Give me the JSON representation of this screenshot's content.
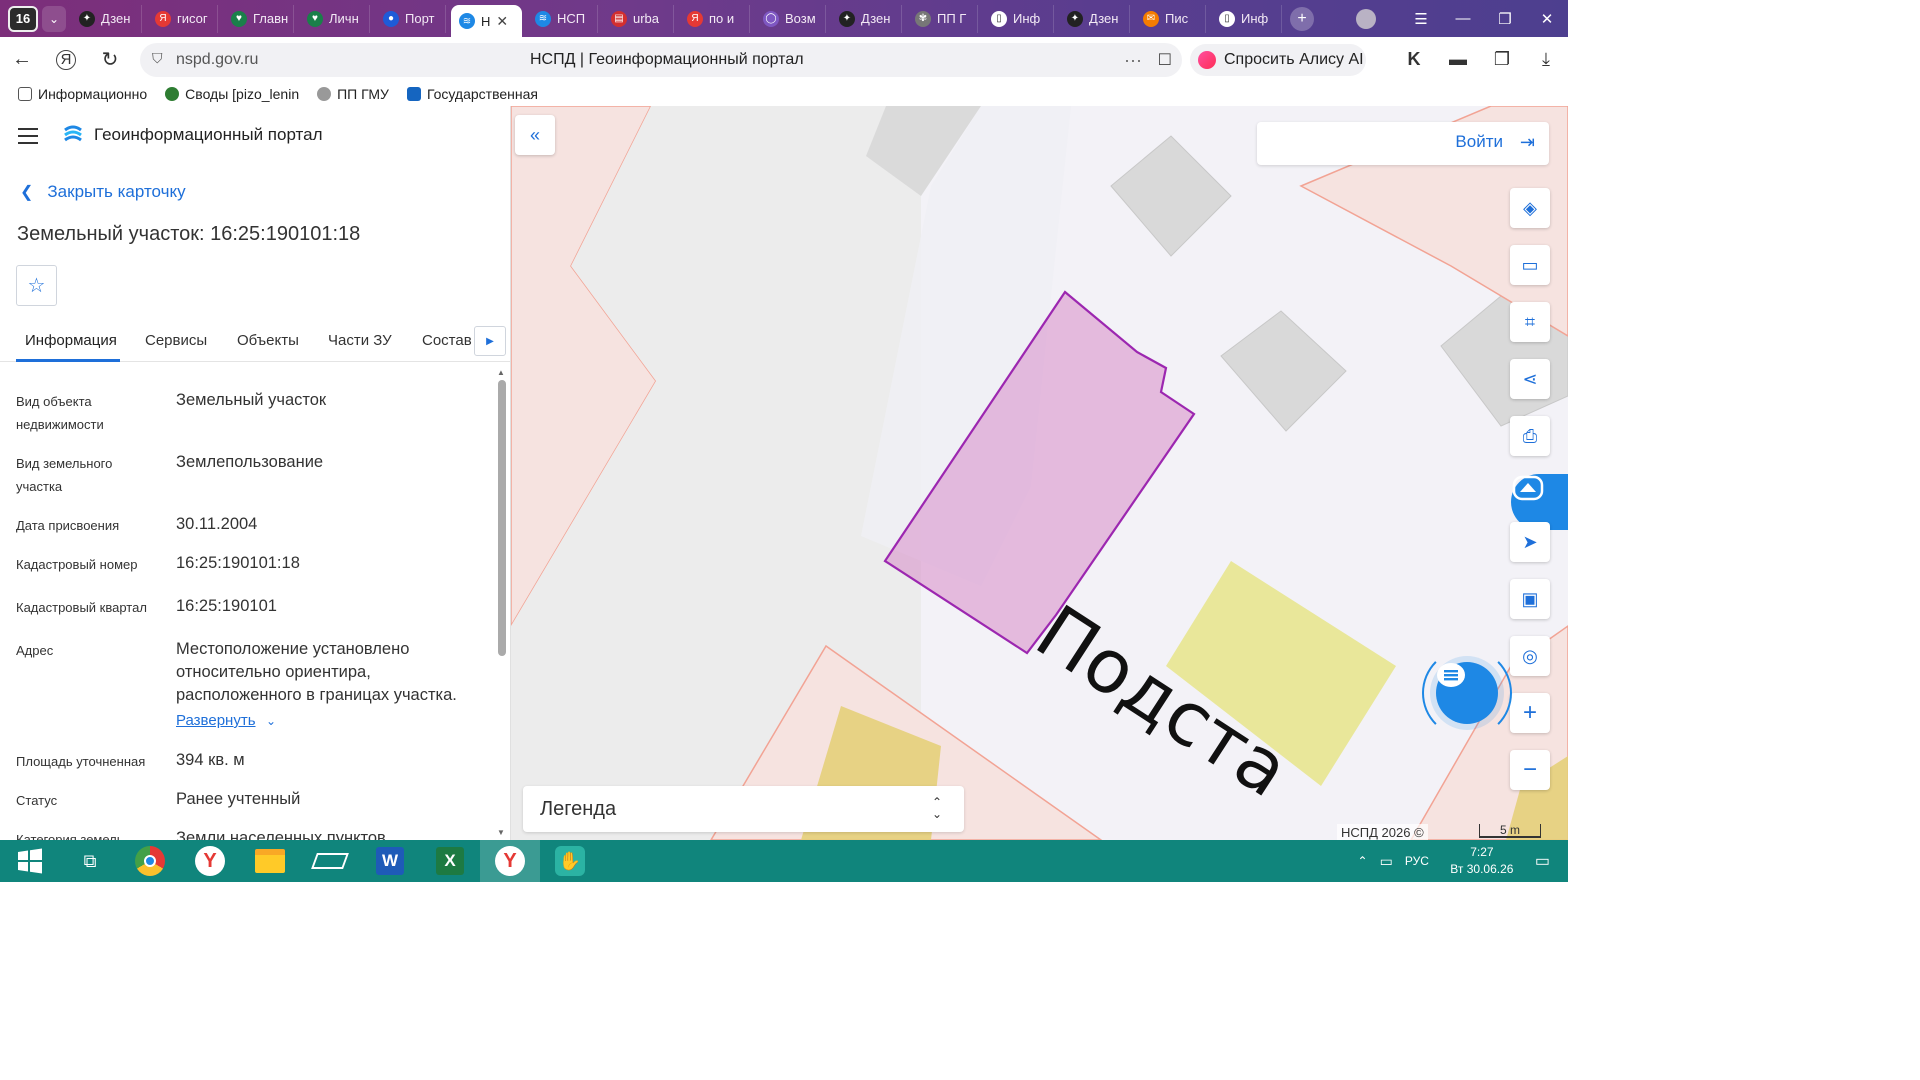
{
  "browser": {
    "tab_count": "16",
    "tabs": [
      {
        "label": "Дзен",
        "color": "#222222",
        "glyph": "✦"
      },
      {
        "label": "гисог",
        "color": "#e53935",
        "glyph": "Я"
      },
      {
        "label": "Главн",
        "color": "#1a7f4a",
        "glyph": "♥"
      },
      {
        "label": "Личн",
        "color": "#1a7f4a",
        "glyph": "♥"
      },
      {
        "label": "Порт",
        "color": "#1e5bd8",
        "glyph": "●"
      },
      {
        "label": "Н",
        "color": "#1e88e5",
        "glyph": "≋",
        "active": true
      },
      {
        "label": "НСП",
        "color": "#1e88e5",
        "glyph": "≋"
      },
      {
        "label": "urba",
        "color": "#d32f2f",
        "glyph": "▤"
      },
      {
        "label": "по и",
        "color": "#e53935",
        "glyph": "Я"
      },
      {
        "label": "Возм",
        "color": "#7e57c2",
        "glyph": "◯"
      },
      {
        "label": "Дзен",
        "color": "#222222",
        "glyph": "✦"
      },
      {
        "label": "ПП Г",
        "color": "#777777",
        "glyph": "✾"
      },
      {
        "label": "Инф",
        "color": "#ffffff",
        "glyph": "▯"
      },
      {
        "label": "Дзен",
        "color": "#222222",
        "glyph": "✦"
      },
      {
        "label": "Пис",
        "color": "#f57c00",
        "glyph": "✉"
      },
      {
        "label": "Инф",
        "color": "#ffffff",
        "glyph": "▯"
      }
    ],
    "url_domain": "nspd.gov.ru",
    "page_title": "НСПД | Геоинформационный портал",
    "alice_label": "Спросить Алису AI",
    "bookmarks": [
      {
        "label": "Информационно",
        "color": "#555555"
      },
      {
        "label": "Своды [pizo_lenin",
        "color": "#2e7d32"
      },
      {
        "label": "ПП ГМУ",
        "color": "#777777"
      },
      {
        "label": "Государственная",
        "color": "#1565c0"
      }
    ]
  },
  "portal": {
    "title": "Геоинформационный портал",
    "close_card": "Закрыть карточку",
    "object_title": "Земельный участок: 16:25:190101:18",
    "tabs": [
      "Информация",
      "Сервисы",
      "Объекты",
      "Части ЗУ",
      "Состав"
    ],
    "properties": [
      {
        "key": "Вид объекта недвижимости",
        "value": "Земельный участок"
      },
      {
        "key": "Вид земельного участка",
        "value": "Землепользование"
      },
      {
        "key": "Дата присвоения",
        "value": "30.11.2004"
      },
      {
        "key": "Кадастровый номер",
        "value": "16:25:190101:18"
      },
      {
        "key": "Кадастровый квартал",
        "value": "16:25:190101"
      },
      {
        "key": "Адрес",
        "value": "Местоположение установлено относительно ориентира, расположенного в границах участка."
      },
      {
        "key": "Площадь уточненная",
        "value": "394 кв. м"
      },
      {
        "key": "Статус",
        "value": "Ранее учтенный"
      },
      {
        "key": "Категория земель",
        "value": "Земли населенных пунктов"
      }
    ],
    "expand_label": "Развернуть"
  },
  "map": {
    "login_label": "Войти",
    "legend_label": "Легенда",
    "copyright": "НСПД 2026 ©",
    "scale": "5 m",
    "street_label": "Подста",
    "parcel_color": "#9c27b0"
  },
  "taskbar": {
    "lang": "РУС",
    "time": "7:27",
    "date": "Вт 30.06.26"
  }
}
